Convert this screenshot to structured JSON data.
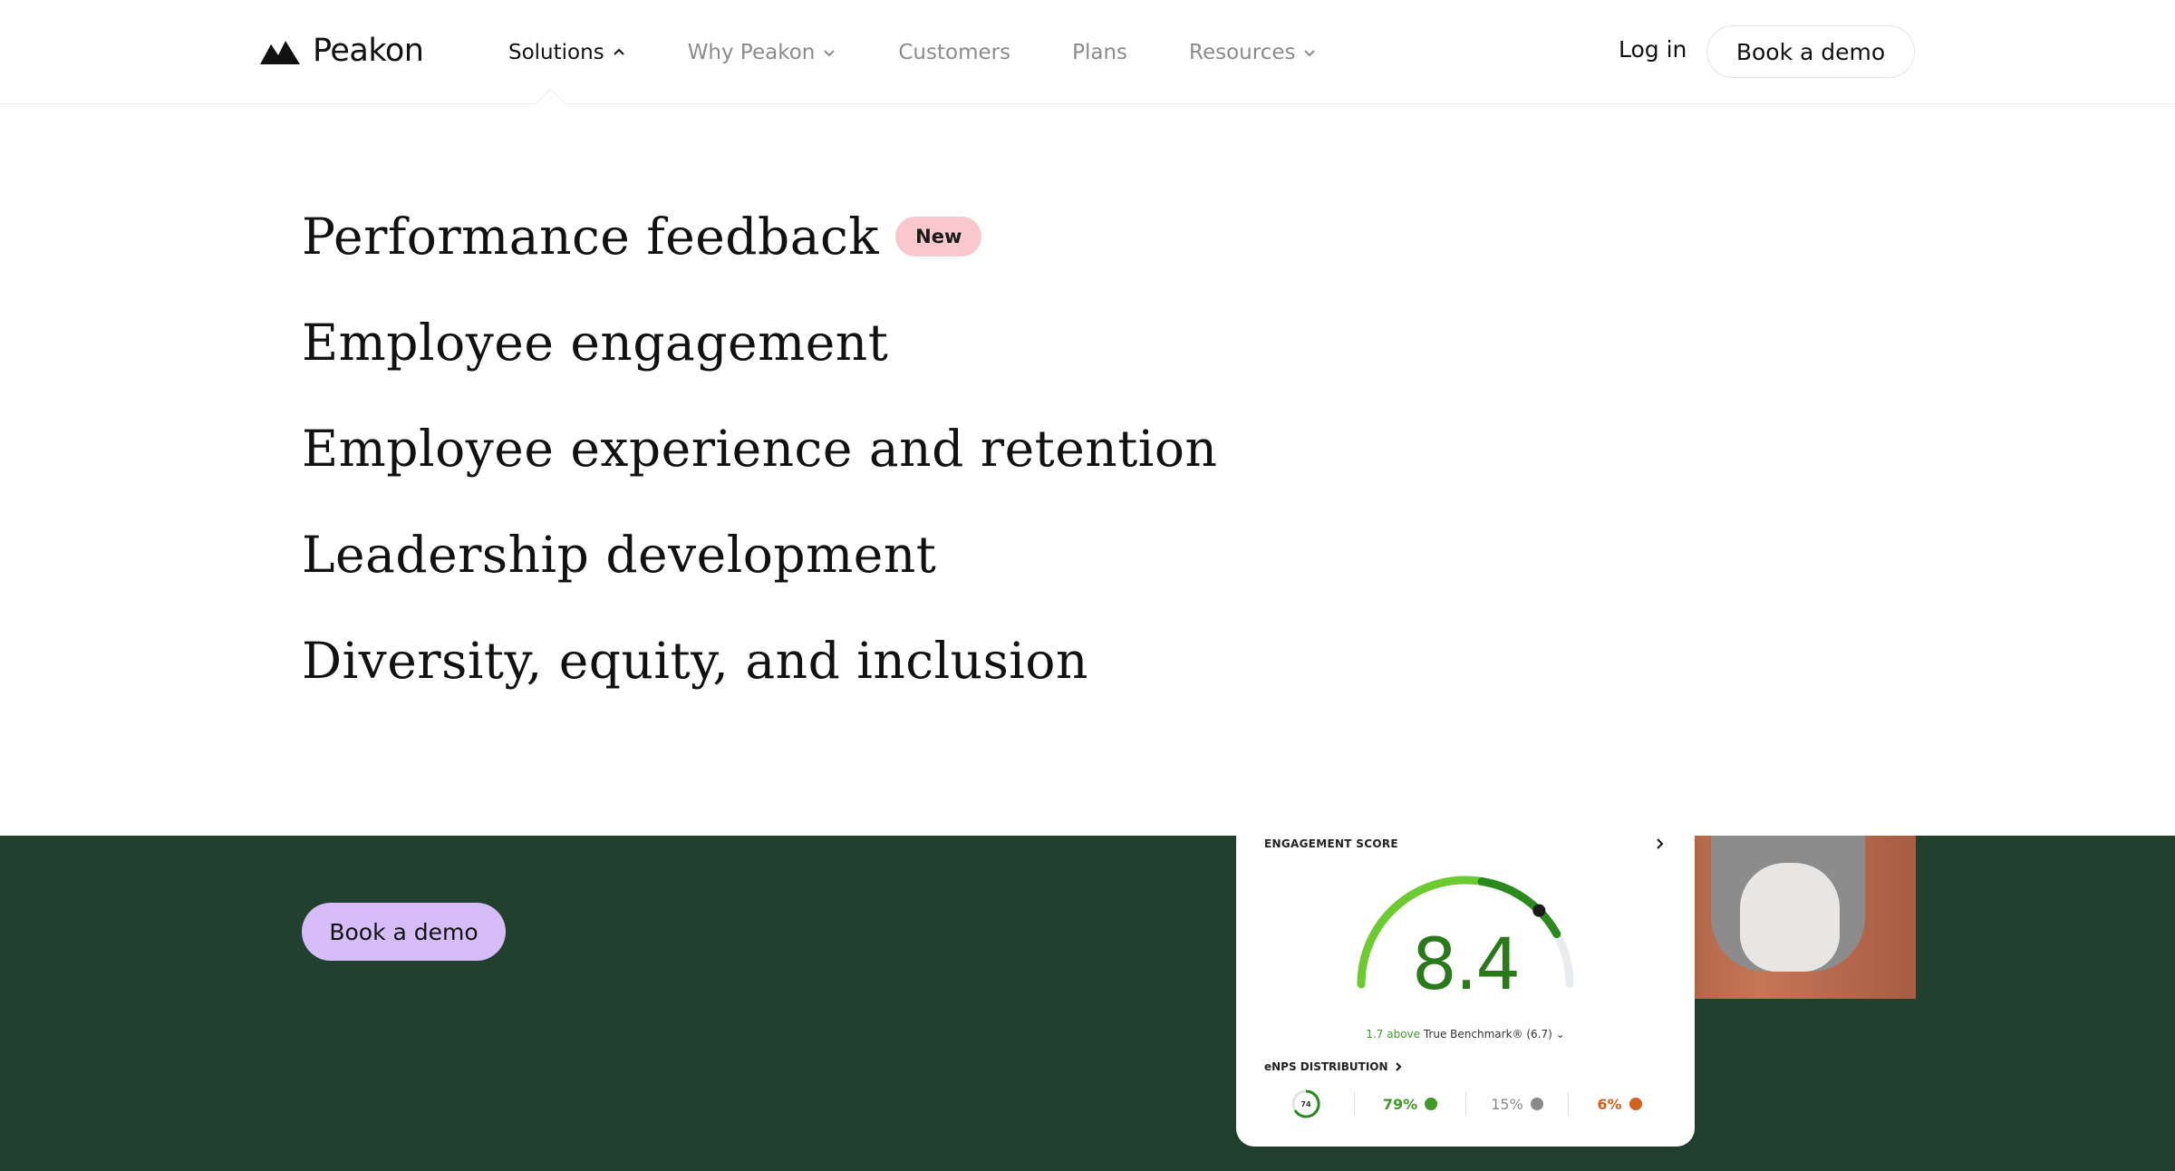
{
  "header": {
    "logo_text": "Peakon",
    "nav": [
      {
        "label": "Solutions",
        "chevron": "up"
      },
      {
        "label": "Why Peakon",
        "chevron": "down"
      },
      {
        "label": "Customers"
      },
      {
        "label": "Plans"
      },
      {
        "label": "Resources",
        "chevron": "down"
      }
    ],
    "login_label": "Log in",
    "demo_label": "Book a demo"
  },
  "dropdown": {
    "items": [
      {
        "label": "Performance feedback",
        "badge": "New"
      },
      {
        "label": "Employee engagement"
      },
      {
        "label": "Employee experience and retention"
      },
      {
        "label": "Leadership development"
      },
      {
        "label": "Diversity, equity, and inclusion"
      }
    ]
  },
  "hero": {
    "demo_label": "Book a demo"
  },
  "card": {
    "title": "ENGAGEMENT SCORE",
    "score": "8.4",
    "score_fraction": 0.84,
    "benchmark_delta": "1.7 above",
    "benchmark_label": "True Benchmark® (6.7)",
    "enps_title": "eNPS DISTRIBUTION",
    "enps_score": "74",
    "promoters": "79%",
    "passives": "15%",
    "detractors": "6%"
  },
  "colors": {
    "green_bg": "#22402e",
    "purple_button": "#d6bdf9",
    "badge_pink": "#f9c8cc",
    "score_green": "#2a7a1a",
    "detractor_orange": "#d2611c"
  }
}
